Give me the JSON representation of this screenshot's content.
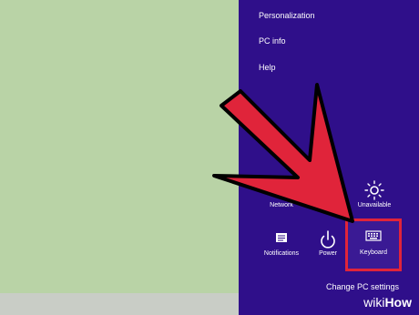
{
  "charms": {
    "menu": [
      {
        "label": "Personalization"
      },
      {
        "label": "PC info"
      },
      {
        "label": "Help"
      }
    ],
    "tiles": {
      "network": "Network",
      "unavailable": "Unavailable",
      "notifications": "Notifications",
      "power": "Power",
      "keyboard": "Keyboard"
    },
    "change_pc_settings": "Change PC settings"
  },
  "watermark": {
    "wiki": "wiki",
    "how": "How"
  },
  "colors": {
    "charms_bg": "#2f0f8a",
    "desktop_bg": "#b9d3a6",
    "taskbar_bg": "#c9cdc6",
    "arrow": "#e0243a",
    "highlight": "#e0243a"
  }
}
